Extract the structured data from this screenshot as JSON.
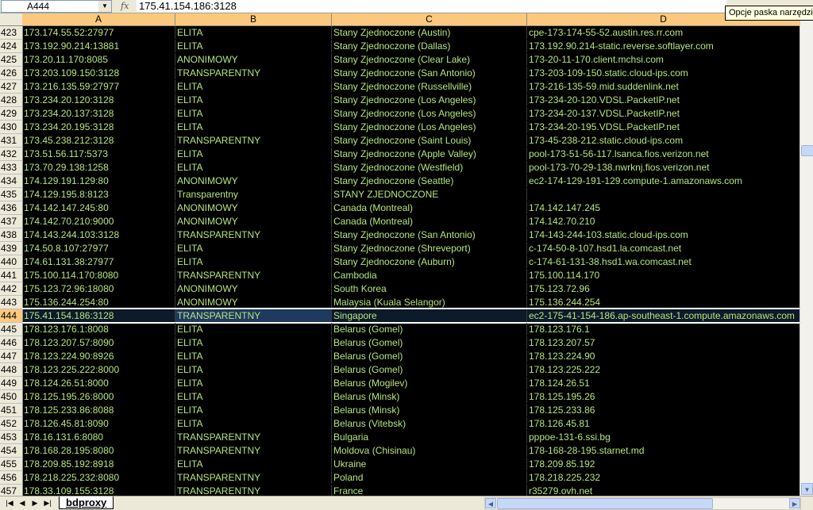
{
  "formula_bar": {
    "name_box": "A444",
    "fx_label": "fx",
    "value": "175.41.154.186:3128"
  },
  "tooltip": "Opcje paska narzędzi",
  "columns": [
    "A",
    "B",
    "C",
    "D"
  ],
  "selected_row": "444",
  "rows": [
    {
      "n": "423",
      "a": "173.174.55.52:27977",
      "b": "ELITA",
      "c": "Stany Zjednoczone (Austin)",
      "d": "cpe-173-174-55-52.austin.res.rr.com"
    },
    {
      "n": "424",
      "a": "173.192.90.214:13881",
      "b": "ELITA",
      "c": "Stany Zjednoczone (Dallas)",
      "d": "173.192.90.214-static.reverse.softlayer.com"
    },
    {
      "n": "425",
      "a": "173.20.11.170:8085",
      "b": "ANONIMOWY",
      "c": "Stany Zjednoczone (Clear Lake)",
      "d": "173-20-11-170.client.mchsi.com"
    },
    {
      "n": "426",
      "a": "173.203.109.150:3128",
      "b": "TRANSPARENTNY",
      "c": "Stany Zjednoczone (San Antonio)",
      "d": "173-203-109-150.static.cloud-ips.com"
    },
    {
      "n": "427",
      "a": "173.216.135.59:27977",
      "b": "ELITA",
      "c": "Stany Zjednoczone (Russellville)",
      "d": "173-216-135-59.mid.suddenlink.net"
    },
    {
      "n": "428",
      "a": "173.234.20.120:3128",
      "b": "ELITA",
      "c": "Stany Zjednoczone (Los Angeles)",
      "d": "173-234-20-120.VDSL.PacketIP.net"
    },
    {
      "n": "429",
      "a": "173.234.20.137:3128",
      "b": "ELITA",
      "c": "Stany Zjednoczone (Los Angeles)",
      "d": "173-234-20-137.VDSL.PacketIP.net"
    },
    {
      "n": "430",
      "a": "173.234.20.195:3128",
      "b": "ELITA",
      "c": "Stany Zjednoczone (Los Angeles)",
      "d": "173-234-20-195.VDSL.PacketIP.net"
    },
    {
      "n": "431",
      "a": "173.45.238.212:3128",
      "b": "TRANSPARENTNY",
      "c": "Stany Zjednoczone (Saint Louis)",
      "d": "173-45-238-212.static.cloud-ips.com"
    },
    {
      "n": "432",
      "a": "173.51.56.117:5373",
      "b": "ELITA",
      "c": "Stany Zjednoczone (Apple Valley)",
      "d": "pool-173-51-56-117.lsanca.fios.verizon.net"
    },
    {
      "n": "433",
      "a": "173.70.29.138:1258",
      "b": "ELITA",
      "c": "Stany Zjednoczone (Westfield)",
      "d": "pool-173-70-29-138.nwrknj.fios.verizon.net"
    },
    {
      "n": "434",
      "a": "174.129.191.129:80",
      "b": "ANONIMOWY",
      "c": "Stany Zjednoczone (Seattle)",
      "d": "ec2-174-129-191-129.compute-1.amazonaws.com"
    },
    {
      "n": "435",
      "a": "174.129.195.8:8123",
      "b": "Transparentny",
      "c": "STANY ZJEDNOCZONE",
      "d": ""
    },
    {
      "n": "436",
      "a": "174.142.147.245:80",
      "b": "ANONIMOWY",
      "c": "Canada (Montreal)",
      "d": "174.142.147.245"
    },
    {
      "n": "437",
      "a": "174.142.70.210:9000",
      "b": "ANONIMOWY",
      "c": "Canada (Montreal)",
      "d": "174.142.70.210"
    },
    {
      "n": "438",
      "a": "174.143.244.103:3128",
      "b": "TRANSPARENTNY",
      "c": "Stany Zjednoczone (San Antonio)",
      "d": "174-143-244-103.static.cloud-ips.com"
    },
    {
      "n": "439",
      "a": "174.50.8.107:27977",
      "b": "ELITA",
      "c": "Stany Zjednoczone (Shreveport)",
      "d": "c-174-50-8-107.hsd1.la.comcast.net"
    },
    {
      "n": "440",
      "a": "174.61.131.38:27977",
      "b": "ELITA",
      "c": "Stany Zjednoczone (Auburn)",
      "d": "c-174-61-131-38.hsd1.wa.comcast.net"
    },
    {
      "n": "441",
      "a": "175.100.114.170:8080",
      "b": "TRANSPARENTNY",
      "c": "Cambodia",
      "d": "175.100.114.170"
    },
    {
      "n": "442",
      "a": "175.123.72.96:18080",
      "b": "ANONIMOWY",
      "c": "South Korea",
      "d": "175.123.72.96"
    },
    {
      "n": "443",
      "a": "175.136.244.254:80",
      "b": "ANONIMOWY",
      "c": "Malaysia (Kuala Selangor)",
      "d": "175.136.244.254"
    },
    {
      "n": "444",
      "a": "175.41.154.186:3128",
      "b": "TRANSPARENTNY",
      "c": "Singapore",
      "d": "ec2-175-41-154-186.ap-southeast-1.compute.amazonaws.com"
    },
    {
      "n": "445",
      "a": "178.123.176.1:8008",
      "b": "ELITA",
      "c": "Belarus (Gomel)",
      "d": "178.123.176.1"
    },
    {
      "n": "446",
      "a": "178.123.207.57:8090",
      "b": "ELITA",
      "c": "Belarus (Gomel)",
      "d": "178.123.207.57"
    },
    {
      "n": "447",
      "a": "178.123.224.90:8926",
      "b": "ELITA",
      "c": "Belarus (Gomel)",
      "d": "178.123.224.90"
    },
    {
      "n": "448",
      "a": "178.123.225.222:8000",
      "b": "ELITA",
      "c": "Belarus (Gomel)",
      "d": "178.123.225.222"
    },
    {
      "n": "449",
      "a": "178.124.26.51:8000",
      "b": "ELITA",
      "c": "Belarus (Mogilev)",
      "d": "178.124.26.51"
    },
    {
      "n": "450",
      "a": "178.125.195.26:8000",
      "b": "ELITA",
      "c": "Belarus (Minsk)",
      "d": "178.125.195.26"
    },
    {
      "n": "451",
      "a": "178.125.233.86:8088",
      "b": "ELITA",
      "c": "Belarus (Minsk)",
      "d": "178.125.233.86"
    },
    {
      "n": "452",
      "a": "178.126.45.81:8090",
      "b": "ELITA",
      "c": "Belarus (Vitebsk)",
      "d": "178.126.45.81"
    },
    {
      "n": "453",
      "a": "178.16.131.6:8080",
      "b": "TRANSPARENTNY",
      "c": "Bulgaria",
      "d": "pppoe-131-6.ssi.bg"
    },
    {
      "n": "454",
      "a": "178.168.28.195:8080",
      "b": "TRANSPARENTNY",
      "c": "Moldova (Chisinau)",
      "d": "178-168-28-195.starnet.md"
    },
    {
      "n": "455",
      "a": "178.209.85.192:8918",
      "b": "ELITA",
      "c": "Ukraine",
      "d": "178.209.85.192"
    },
    {
      "n": "456",
      "a": "178.218.225.232:8080",
      "b": "TRANSPARENTNY",
      "c": "Poland",
      "d": "178.218.225.232"
    },
    {
      "n": "457",
      "a": "178.33.109.155:3128",
      "b": "TRANSPARENTNY",
      "c": "France",
      "d": "r35279.ovh.net"
    }
  ],
  "sheet_tabs": [
    "bdproxy"
  ],
  "nav_icons": [
    "first-sheet-icon",
    "prev-sheet-icon",
    "next-sheet-icon",
    "last-sheet-icon"
  ],
  "colors": {
    "cell_text": "#b6e67c",
    "cell_bg": "#000000",
    "header_bg": "#fbc97d"
  }
}
